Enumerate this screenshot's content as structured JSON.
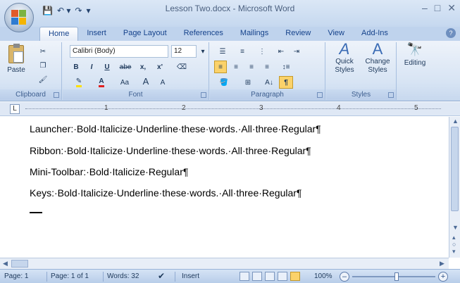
{
  "window": {
    "title": "Lesson Two.docx - Microsoft Word",
    "controls": [
      "–",
      "□",
      "✕"
    ]
  },
  "qat": {
    "save": "💾",
    "undo": "↶ ▾",
    "redo": "↷",
    "more": "▾"
  },
  "tabs": [
    "Home",
    "Insert",
    "Page Layout",
    "References",
    "Mailings",
    "Review",
    "View",
    "Add-Ins"
  ],
  "ribbon": {
    "clipboard": {
      "label": "Clipboard",
      "paste": "Paste"
    },
    "font": {
      "label": "Font",
      "name": "Calibri (Body)",
      "size": "12",
      "bold": "B",
      "italic": "I",
      "underline": "U",
      "strike": "abe",
      "sub": "x,",
      "sup": "x'",
      "clear": "Aa",
      "grow": "A",
      "shrink": "A",
      "case": "Aa"
    },
    "paragraph": {
      "label": "Paragraph",
      "pilcrow": "¶",
      "sort": "A↓"
    },
    "styles": {
      "label": "Styles",
      "quick": "Quick Styles",
      "change": "Change Styles"
    },
    "editing": {
      "label": "Editing"
    }
  },
  "ruler": {
    "tab": "L",
    "numbers": [
      "1",
      "2",
      "3",
      "4",
      "5"
    ]
  },
  "document": {
    "paragraphs": [
      "Launcher:·Bold·Italicize·Underline·these·words.·All·three·Regular¶",
      "Ribbon:·Bold·Italicize·Underline·these·words.·All·three·Regular¶",
      "Mini-Toolbar:·Bold·Italicize·Regular¶",
      "Keys:·Bold·Italicize·Underline·these·words.·All·three·Regular¶"
    ]
  },
  "status": {
    "page": "Page: 1",
    "pages": "Page: 1 of 1",
    "words": "Words: 32",
    "mode": "Insert",
    "zoom": "100%",
    "zoom_minus": "–",
    "zoom_plus": "+"
  }
}
